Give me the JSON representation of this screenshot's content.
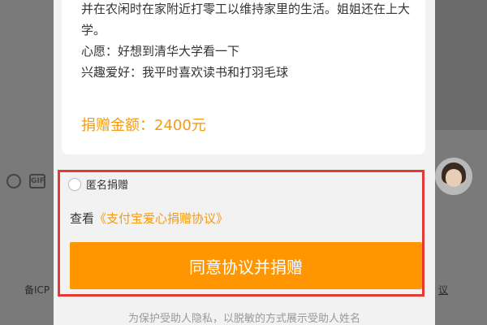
{
  "story": {
    "lines": [
      "并在农闲时在家附近打零工以维持家里的生活。姐姐还在上大",
      "学。",
      "心愿：好想到清华大学看一下",
      "兴趣爱好：我平时喜欢读书和打羽毛球"
    ]
  },
  "donation": {
    "amount_text": "捐赠金额：2400元"
  },
  "anonymous": {
    "label": "匿名捐赠",
    "checked": false
  },
  "agreement": {
    "prefix": "查看",
    "link_text": "《支付宝爱心捐赠协议》"
  },
  "donate_button": {
    "label": "同意协议并捐赠"
  },
  "privacy_note": "为保护受助人隐私，以脱敏的方式展示受助人姓名",
  "background": {
    "footer_left": "备ICP",
    "footer_right": "议"
  },
  "colors": {
    "accent": "#ff9500",
    "amount": "#f39c12",
    "highlight_border": "#e53935"
  }
}
